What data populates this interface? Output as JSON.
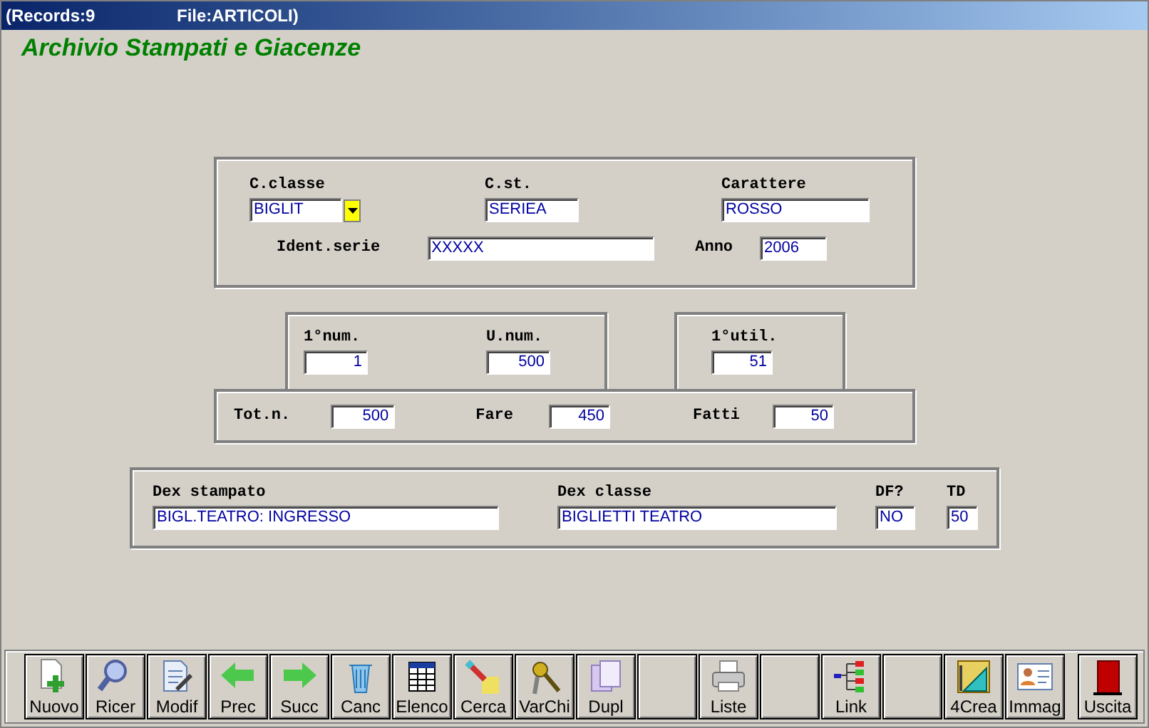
{
  "title_bar": {
    "records": "(Records:9",
    "file": "File:ARTICOLI)"
  },
  "heading": "Archivio Stampati e Giacenze",
  "classification": [
    {
      "label": "C.classe",
      "value": "BIGLIT",
      "kind": "dropdown"
    },
    {
      "label": "C.st.",
      "value": "SERIEA"
    },
    {
      "label": "Carattere",
      "value": "ROSSO"
    },
    {
      "label": "Ident.serie",
      "value": "XXXXX"
    },
    {
      "label": "Anno",
      "value": "2006"
    }
  ],
  "numbering": [
    {
      "label": "1°num.",
      "value": "1",
      "kind": "number"
    },
    {
      "label": "U.num.",
      "value": "500",
      "kind": "number"
    }
  ],
  "usage": [
    {
      "label": "1°util.",
      "value": "51",
      "kind": "number"
    }
  ],
  "totals": [
    {
      "label": "Tot.n.",
      "value": "500",
      "kind": "number"
    },
    {
      "label": "Fare",
      "value": "450",
      "kind": "number"
    },
    {
      "label": "Fatti",
      "value": "50",
      "kind": "number"
    }
  ],
  "descriptions": [
    {
      "label": "Dex stampato",
      "value": "BIGL.TEATRO: INGRESSO"
    },
    {
      "label": "Dex classe",
      "value": "BIGLIETTI TEATRO"
    },
    {
      "label": "DF?",
      "value": "NO"
    },
    {
      "label": "TD",
      "value": "50"
    }
  ],
  "toolbar": [
    {
      "label": "Nuovo",
      "kind": "new"
    },
    {
      "label": "Ricer",
      "kind": "search"
    },
    {
      "label": "Modif",
      "kind": "edit"
    },
    {
      "label": "Prec",
      "kind": "prev"
    },
    {
      "label": "Succ",
      "kind": "next"
    },
    {
      "label": "Canc",
      "kind": "delete"
    },
    {
      "label": "Elenco",
      "kind": "list"
    },
    {
      "label": "Cerca",
      "kind": "find"
    },
    {
      "label": "VarChi",
      "kind": "keys"
    },
    {
      "label": "Dupl",
      "kind": "duplicate"
    },
    {
      "kind": "empty"
    },
    {
      "label": "Liste",
      "kind": "print"
    },
    {
      "kind": "empty"
    },
    {
      "label": "Link",
      "kind": "link"
    },
    {
      "kind": "empty"
    },
    {
      "label": "4Crea",
      "kind": "create"
    },
    {
      "label": "Immag",
      "kind": "image"
    },
    {
      "label": "Uscita",
      "kind": "exit"
    }
  ]
}
